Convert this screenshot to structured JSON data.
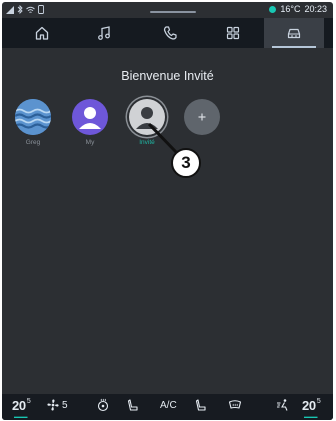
{
  "statusbar": {
    "left_icons": [
      "signal-icon",
      "bluetooth-icon",
      "wifi-icon",
      "phone-battery-icon"
    ],
    "temperature": "16°C",
    "time": "20:23",
    "status_dot_color": "#18c7b3"
  },
  "tabs": [
    {
      "name": "home",
      "icon": "home-icon",
      "active": false
    },
    {
      "name": "music",
      "icon": "music-icon",
      "active": false
    },
    {
      "name": "phone",
      "icon": "phone-icon",
      "active": false
    },
    {
      "name": "apps",
      "icon": "apps-grid-icon",
      "active": false
    },
    {
      "name": "vehicle",
      "icon": "car-icon",
      "active": true
    }
  ],
  "main": {
    "title": "Bienvenue Invité",
    "profiles": [
      {
        "label": "Greg",
        "avatar": "waves-icon",
        "color": "#4d86c4",
        "selected": false
      },
      {
        "label": "My",
        "avatar": "person-icon",
        "color": "#6e57d9",
        "selected": false
      },
      {
        "label": "Invité",
        "avatar": "person-icon",
        "color": "#c7c9cc",
        "selected": true
      },
      {
        "label": "",
        "avatar": "plus-icon",
        "color": "#6c7279",
        "selected": false
      }
    ],
    "callout_number": "3"
  },
  "bottombar": {
    "left_temp": "20",
    "left_temp_unit": "5",
    "fan_level": "5",
    "ac_label": "A/C",
    "right_temp": "20",
    "right_temp_unit": "5",
    "icons": [
      "steering-heat-icon",
      "seat-heat-icon",
      "seat-heat-icon",
      "windshield-icon",
      "fan-person-icon"
    ]
  },
  "colors": {
    "accent": "#18c7b3",
    "background": "#2c2f33",
    "tabbar": "#151a20"
  }
}
